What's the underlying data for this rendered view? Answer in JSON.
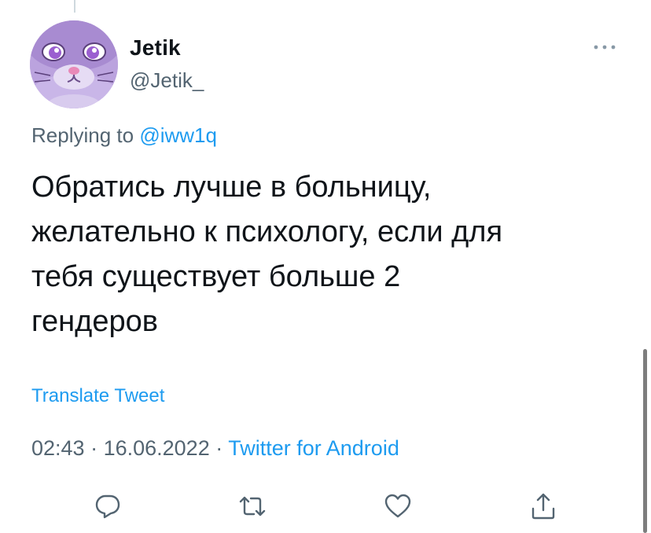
{
  "user": {
    "display_name": "Jetik",
    "handle": "@Jetik_"
  },
  "reply": {
    "prefix": "Replying to",
    "mention": "@iww1q"
  },
  "tweet": {
    "lines": [
      "Обратись лучше в больницу,",
      "желательно к психологу, если для",
      "тебя существует больше 2",
      "гендеров"
    ]
  },
  "translate_label": "Translate Tweet",
  "meta": {
    "time": "02:43",
    "separator": " · ",
    "date": "16.06.2022",
    "source": "Twitter for Android"
  },
  "icons": {
    "more": "more-horizontal-icon",
    "reply": "reply-icon",
    "retweet": "retweet-icon",
    "like": "like-icon",
    "share": "share-icon"
  },
  "colors": {
    "accent": "#1d9bf0",
    "text_primary": "#0f1419",
    "text_secondary": "#536471",
    "avatar_purple": "#b8a0dc"
  }
}
